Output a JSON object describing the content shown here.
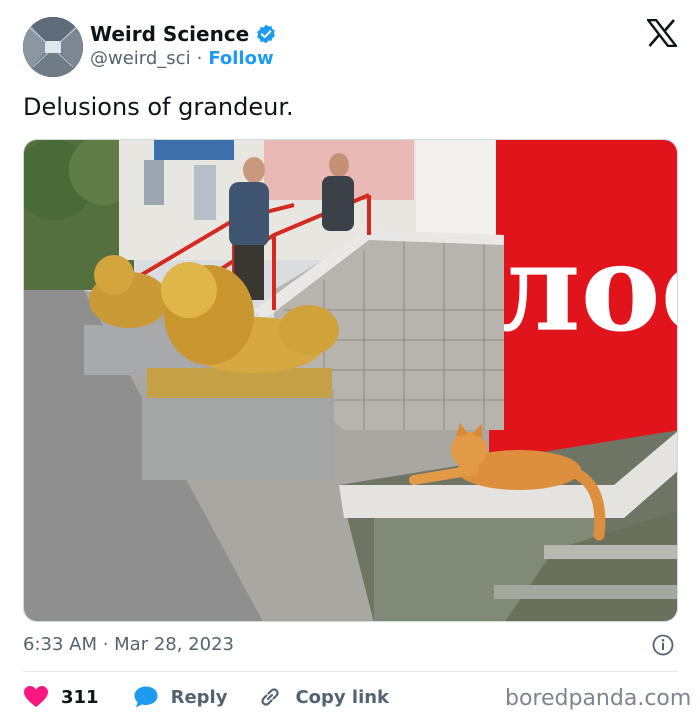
{
  "author": {
    "display_name": "Weird Science",
    "handle": "@weird_sci",
    "separator": "·",
    "follow_label": "Follow",
    "verified": true,
    "avatar_icon": "tunnel-avatar"
  },
  "platform_icon": "x-logo-icon",
  "tweet": {
    "text": "Delusions of grandeur.",
    "timestamp": "6:33 AM · Mar 28, 2023"
  },
  "photo": {
    "sign_text": "лое"
  },
  "actions": {
    "like_count": "311",
    "reply_label": "Reply",
    "copy_link_label": "Copy link"
  },
  "watermark": "boredpanda.com",
  "colors": {
    "verified_blue": "#1d9bf0",
    "heart_red": "#f91880",
    "reply_blue": "#1d9bf0",
    "text_gray": "#536471"
  }
}
